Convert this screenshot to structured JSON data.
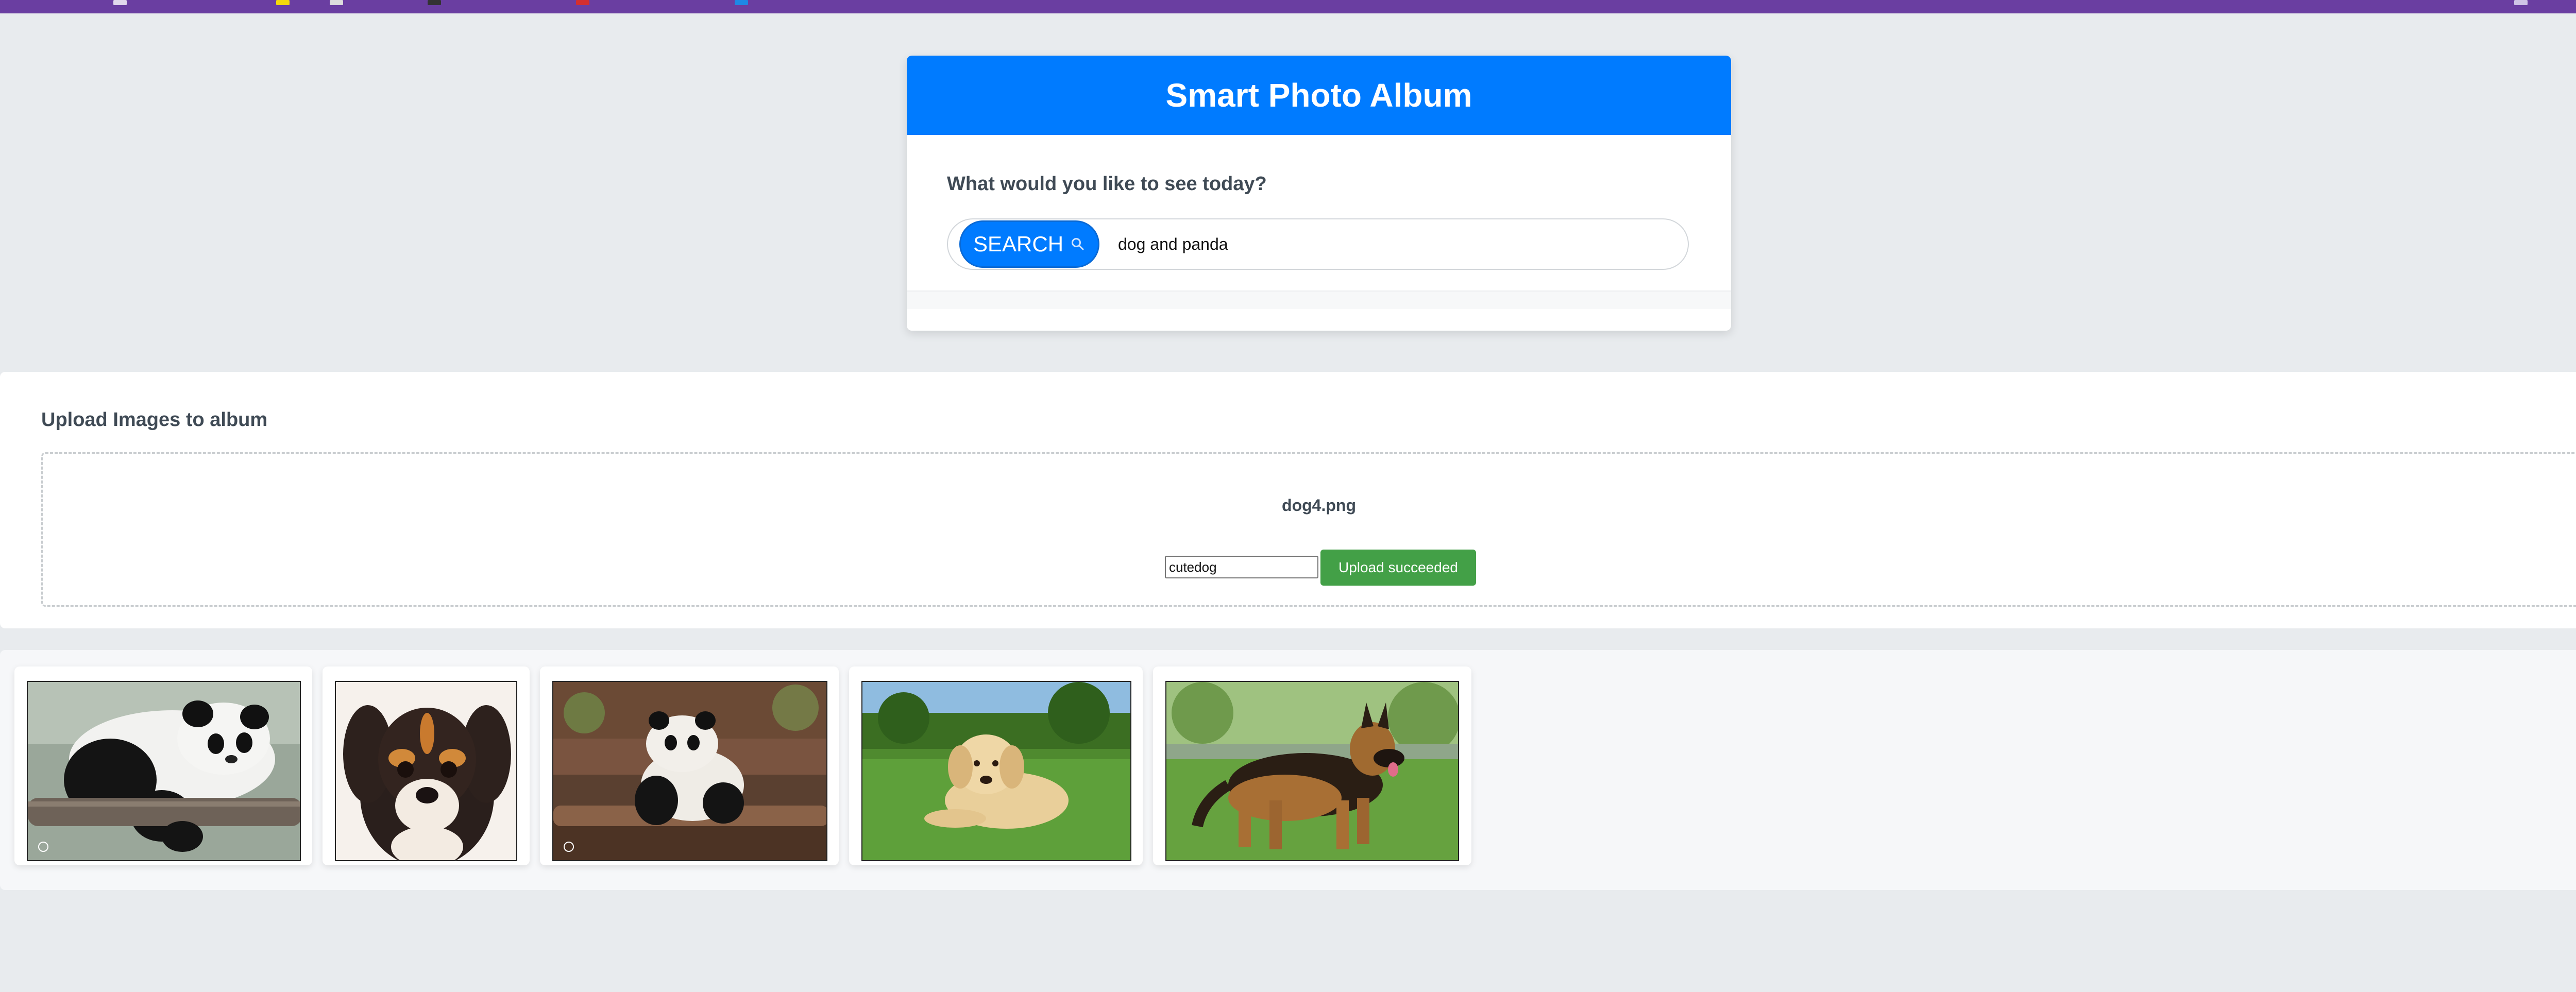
{
  "app": {
    "title": "Smart Photo Album"
  },
  "search": {
    "prompt": "What would you like to see today?",
    "button_label": "SEARCH",
    "query": "dog and panda"
  },
  "upload": {
    "heading": "Upload Images to album",
    "file_name": "dog4.png",
    "label_value": "cutedog",
    "button_label": "Upload succeeded"
  },
  "gallery": {
    "photos": [
      {
        "subject": "panda lying on a log"
      },
      {
        "subject": "tricolor puppy close-up"
      },
      {
        "subject": "panda cub on logs"
      },
      {
        "subject": "golden retriever puppy on grass"
      },
      {
        "subject": "german shepherd standing on grass"
      }
    ]
  },
  "colors": {
    "primary": "#007bff",
    "success": "#43a047",
    "topbar": "#6a3ea1",
    "background": "#e8ebee"
  },
  "icons": {
    "search": "magnifier-icon"
  }
}
